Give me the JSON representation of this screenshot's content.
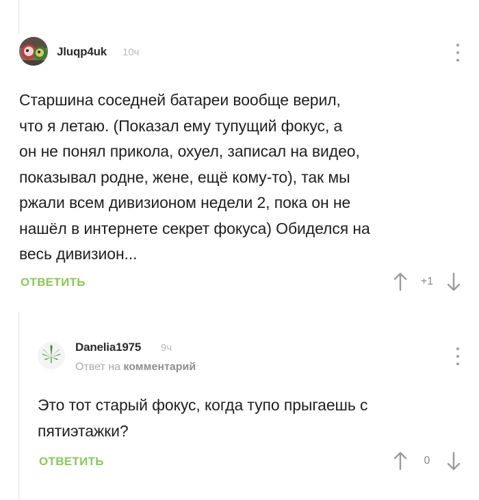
{
  "comments": [
    {
      "username": "Jluqp4uk",
      "time": "10ч",
      "text": "Старшина соседней батареи вообще верил,\nчто я летаю. (Показал ему тупущий фокус, а\nон не понял прикола, охуел, записал на видео,\nпоказывал родне, жене, ещё кому-то), так мы\nржали всем дивизионом недели 2, пока он не\nнашёл в интернете секрет фокуса) Обиделся на\nвесь дивизион...",
      "reply_label": "ОТВЕТИТЬ",
      "score": "+1"
    },
    {
      "username": "Danelia1975",
      "time": "9ч",
      "reply_prefix": "Ответ на",
      "reply_target": "комментарий",
      "text": "Это тот старый фокус, когда тупо прыгаешь с\nпятиэтажки?",
      "reply_label": "ОТВЕТИТЬ",
      "score": "0"
    }
  ],
  "icons": {
    "upvote": "arrow-up-icon",
    "downvote": "arrow-down-icon",
    "more": "more-vertical-icon"
  },
  "colors": {
    "accent": "#8ac858",
    "muted": "#b9b9b9"
  }
}
